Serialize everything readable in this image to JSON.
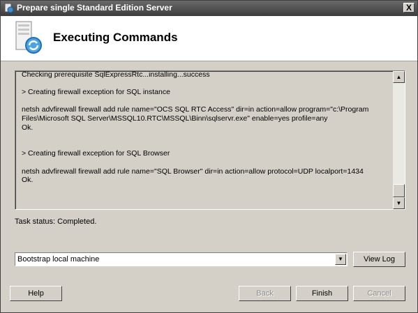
{
  "window": {
    "title": "Prepare single Standard Edition Server",
    "close_label": "X"
  },
  "header": {
    "title": "Executing Commands"
  },
  "log": {
    "text": "Checking prerequisite SqlExpressRtc...installing...success\n\n> Creating firewall exception for SQL instance\n\nnetsh advfirewall firewall add rule name=\"OCS SQL RTC Access\" dir=in action=allow program=\"c:\\Program Files\\Microsoft SQL Server\\MSSQL10.RTC\\MSSQL\\Binn\\sqlservr.exe\" enable=yes profile=any\nOk.\n\n\n> Creating firewall exception for SQL Browser\n\nnetsh advfirewall firewall add rule name=\"SQL Browser\" dir=in action=allow protocol=UDP localport=1434\nOk."
  },
  "status": {
    "text": "Task status: Completed."
  },
  "combo": {
    "value": "Bootstrap local machine"
  },
  "buttons": {
    "view_log": "View Log",
    "help": "Help",
    "back": "Back",
    "finish": "Finish",
    "cancel": "Cancel"
  },
  "scrollbar": {
    "up_glyph": "▲",
    "down_glyph": "▼"
  },
  "combo_glyph": "▼"
}
